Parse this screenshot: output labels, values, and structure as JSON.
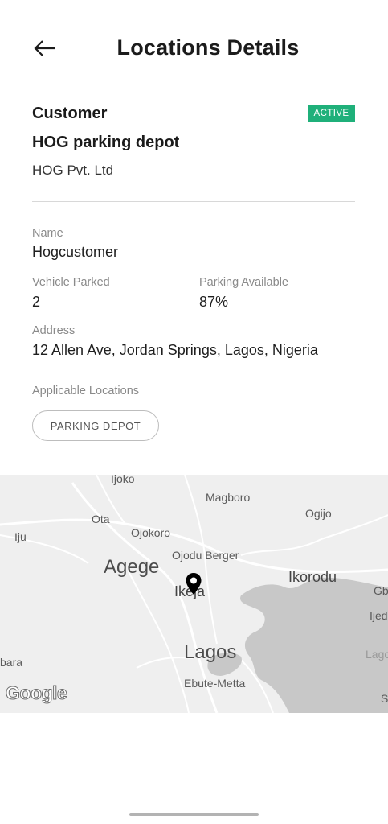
{
  "header": {
    "title": "Locations Details",
    "back_icon": "arrow-left-icon"
  },
  "summary": {
    "type": "Customer",
    "status": "ACTIVE",
    "status_color": "#1fb07a",
    "location_name": "HOG parking depot",
    "company": "HOG Pvt. Ltd"
  },
  "details": {
    "name_label": "Name",
    "name_value": "Hogcustomer",
    "vehicle_label": "Vehicle Parked",
    "vehicle_value": "2",
    "parking_label": "Parking Available",
    "parking_value": "87%",
    "address_label": "Address",
    "address_value": "12 Allen Ave, Jordan Springs, Lagos, Nigeria",
    "applicable_label": "Applicable Locations",
    "applicable_locations": [
      "PARKING DEPOT"
    ]
  },
  "map": {
    "labels": {
      "ijoko": "Ijoko",
      "magboro": "Magboro",
      "ota": "Ota",
      "ogijo": "Ogijo",
      "iju": "Iju",
      "ojokoro": "Ojokoro",
      "ojodu": "Ojodu Berger",
      "agege": "Agege",
      "ikorodu": "Ikorodu",
      "ikeja": "Ikeja",
      "gb": "Gb",
      "ije": "Ijed",
      "lagos": "Lagos",
      "lago_partial": "Lago",
      "bara": "bara",
      "ebute": "Ebute-Metta",
      "s": "S"
    },
    "attribution": "Google",
    "pin_icon": "map-pin-icon"
  }
}
